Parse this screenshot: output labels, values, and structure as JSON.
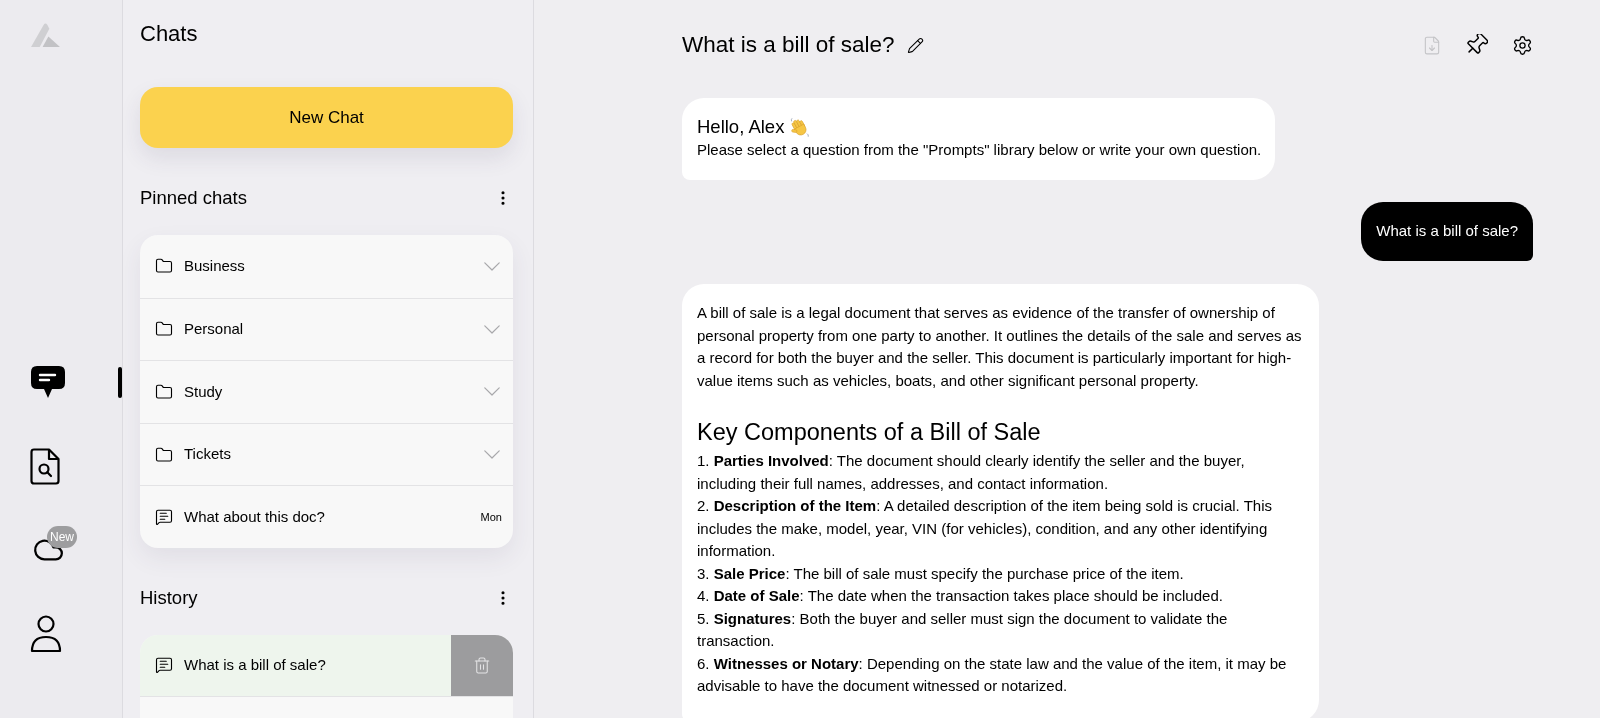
{
  "rail": {
    "items": [
      {
        "kind": "chat",
        "selected": true
      },
      {
        "kind": "document-search",
        "selected": false
      },
      {
        "kind": "cloud",
        "selected": false,
        "badge": "New"
      },
      {
        "kind": "user",
        "selected": false
      }
    ]
  },
  "sidebar": {
    "title": "Chats",
    "new_chat_button": "New Chat",
    "pinned_chats": {
      "heading": "Pinned chats",
      "items": [
        {
          "kind": "folder",
          "label": "Business",
          "expanded": false
        },
        {
          "kind": "folder",
          "label": "Personal",
          "expanded": false
        },
        {
          "kind": "folder",
          "label": "Study",
          "expanded": false
        },
        {
          "kind": "folder",
          "label": "Tickets",
          "expanded": false
        },
        {
          "kind": "chat",
          "label": "What about this doc?",
          "time": "Mon"
        }
      ]
    },
    "history": {
      "heading": "History",
      "items": [
        {
          "label": "What is a bill of sale?",
          "selected": true
        }
      ]
    }
  },
  "chat": {
    "title": "What is a bill of sale?",
    "toolbar": [
      {
        "kind": "download",
        "disabled": true
      },
      {
        "kind": "pin",
        "disabled": false
      },
      {
        "kind": "settings",
        "disabled": false
      }
    ],
    "messages": [
      {
        "kind": "greeting",
        "greeting": "Hello, Alex",
        "text": "Please select a question from the \"Prompts\" library below or write your own question."
      },
      {
        "kind": "question",
        "text": "What is a bill of sale?"
      },
      {
        "kind": "answer",
        "paragraph": "A bill of sale is a legal document that serves as evidence of the transfer of ownership of personal property from one party to another. It outlines the details of the sale and serves as a record for both the buyer and the seller. This document is particularly important for high-value items such as vehicles, boats, and other significant personal property.",
        "heading": "Key Components of a Bill of Sale",
        "list": [
          "1. **Parties Involved**: The document should clearly identify the seller and the buyer, including their full names, addresses, and contact information.",
          "2. **Description of the Item**: A detailed description of the item being sold is crucial. This includes the make, model, year, VIN (for vehicles), condition, and any other identifying information.",
          "3. **Sale Price**: The bill of sale must specify the purchase price of the item.",
          "4. **Date of Sale**: The date when the transaction takes place should be included.",
          "5. **Signatures**: Both the buyer and seller must sign the document to validate the transaction.",
          "6. **Witnesses or Notary**: Depending on the state law and the value of the item, it may be advisable to have the document witnessed or notarized."
        ]
      }
    ]
  }
}
